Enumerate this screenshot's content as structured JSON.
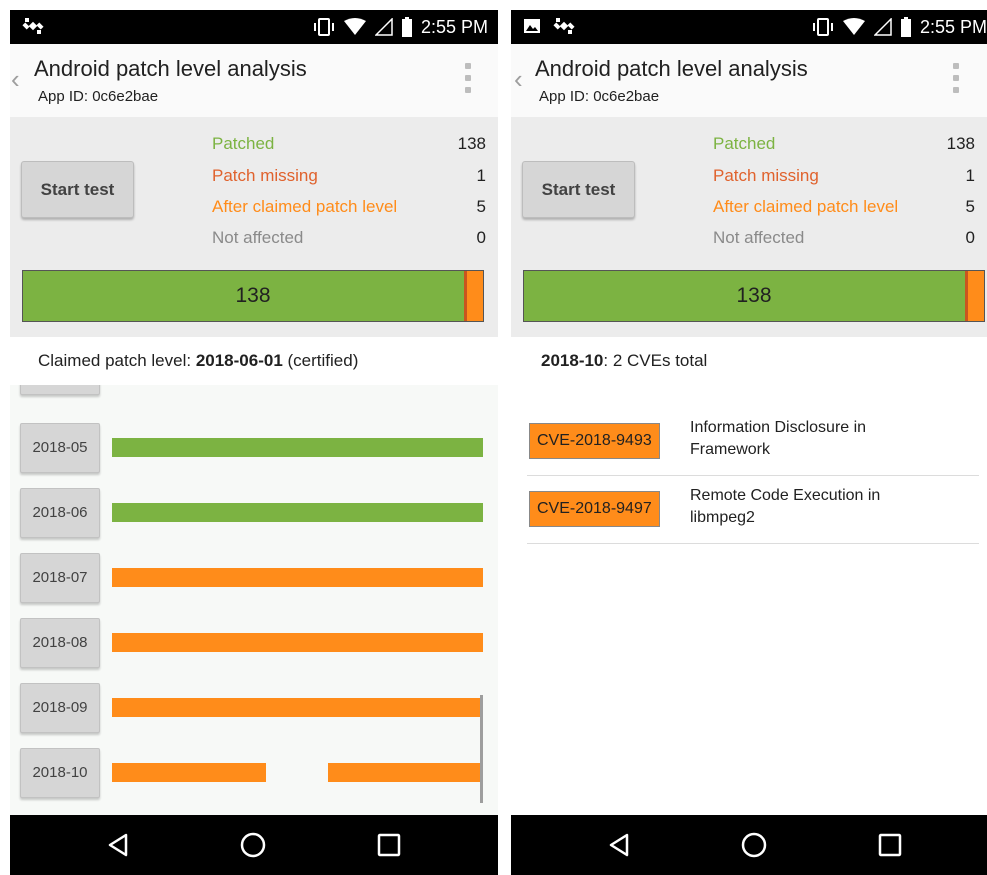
{
  "colors": {
    "patched": "#7cb342",
    "missing": "#e0622d",
    "after": "#ff8c1a",
    "not_affected": "#8a8a8a",
    "status_bar": "#000000",
    "nav_bar": "#000000"
  },
  "left": {
    "status_bar": {
      "time": "2:55 PM",
      "icons": [
        "satellite-icon",
        "vibrate-icon",
        "wifi-icon",
        "signal-icon",
        "battery-icon"
      ]
    },
    "app_bar": {
      "title": "Android patch level analysis",
      "subtitle": "App ID: 0c6e2bae",
      "back_icon": "chevron-left-icon",
      "menu_icon": "overflow-menu-icon"
    },
    "summary": {
      "start_button": "Start test",
      "stats": [
        {
          "label": "Patched",
          "value": "138"
        },
        {
          "label": "Patch missing",
          "value": "1"
        },
        {
          "label": "After claimed patch level",
          "value": "5"
        },
        {
          "label": "Not affected",
          "value": "0"
        }
      ],
      "bar_label": "138",
      "bar_fractions": {
        "patched": 0.958,
        "missing": 0.007,
        "after": 0.035
      }
    },
    "claimed": {
      "prefix": "Claimed patch level: ",
      "date": "2018-06-01",
      "suffix": " (certified)"
    },
    "timeline": [
      {
        "month": "2018-05",
        "status": "patched"
      },
      {
        "month": "2018-06",
        "status": "patched"
      },
      {
        "month": "2018-07",
        "status": "after"
      },
      {
        "month": "2018-08",
        "status": "after"
      },
      {
        "month": "2018-09",
        "status": "after"
      },
      {
        "month": "2018-10",
        "status": "after"
      }
    ],
    "nav_icons": [
      "back-triangle-icon",
      "home-circle-icon",
      "recents-square-icon"
    ]
  },
  "right": {
    "status_bar": {
      "time": "2:55 PM",
      "icons": [
        "image-icon",
        "satellite-icon",
        "vibrate-icon",
        "wifi-icon",
        "signal-icon",
        "battery-icon"
      ]
    },
    "app_bar": {
      "title": "Android patch level analysis",
      "subtitle": "App ID: 0c6e2bae"
    },
    "summary": {
      "start_button": "Start test",
      "stats": [
        {
          "label": "Patched",
          "value": "138"
        },
        {
          "label": "Patch missing",
          "value": "1"
        },
        {
          "label": "After claimed patch level",
          "value": "5"
        },
        {
          "label": "Not affected",
          "value": "0"
        }
      ],
      "bar_label": "138"
    },
    "month_detail": {
      "month": "2018-10",
      "suffix": ": 2 CVEs total"
    },
    "cves": [
      {
        "id": "CVE-2018-9493",
        "line1": "Information Disclosure in",
        "line2": "Framework"
      },
      {
        "id": "CVE-2018-9497",
        "line1": "Remote Code Execution in",
        "line2": "libmpeg2"
      }
    ]
  }
}
